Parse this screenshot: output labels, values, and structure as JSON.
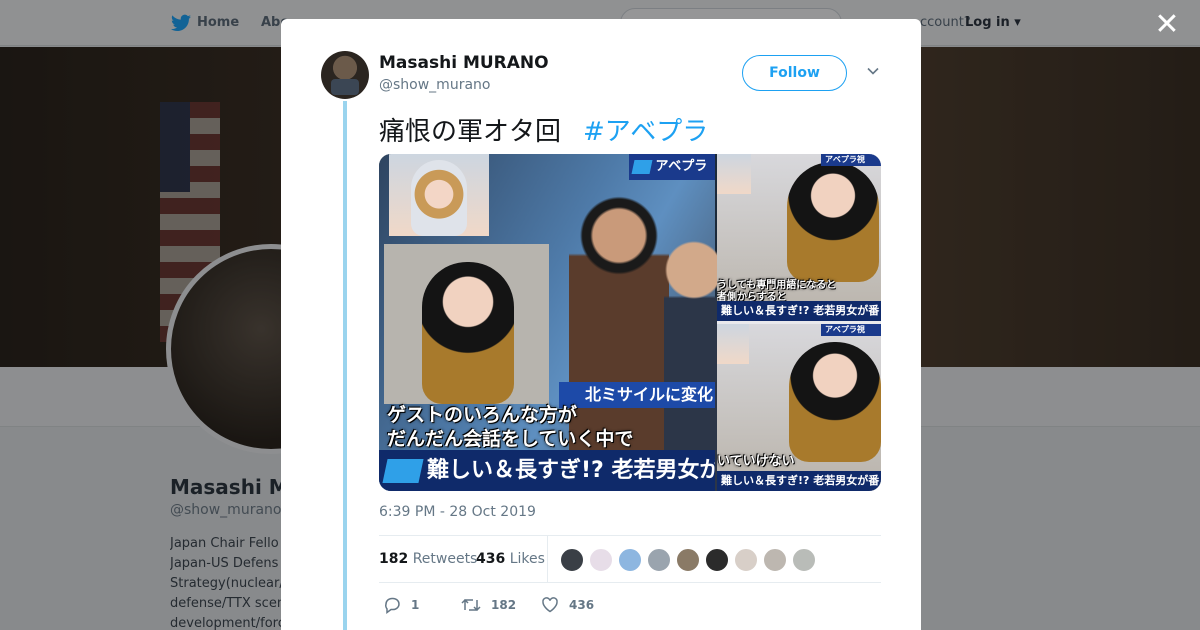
{
  "background_page": {
    "nav": {
      "home": "Home",
      "about": "Abo",
      "account_prompt": "ccount?",
      "login": "Log in"
    },
    "profile": {
      "name": "Masashi MU",
      "handle": "@show_murano",
      "bio_lines": [
        "Japan Chair Fello",
        "Japan-US Defens",
        "Strategy(nuclear/c",
        "defense/TTX scen",
        "development/forc"
      ]
    }
  },
  "tweet": {
    "author_name": "Masashi MURANO",
    "author_handle": "@show_murano",
    "follow_label": "Follow",
    "text": "痛恨の軍オタ回",
    "hashtag": "#アベプラ",
    "timestamp": "6:39 PM - 28 Oct 2019",
    "retweets_count": "182",
    "retweets_label": "Retweets",
    "likes_count": "436",
    "likes_label": "Likes",
    "replies": "1",
    "retweets_action": "182",
    "likes_action": "436",
    "likers": [
      "#3a3f46",
      "#e7dde8",
      "#8db6e0",
      "#9aa4ae",
      "#8a7a66",
      "#2b2b2b",
      "#d8cfc8",
      "#bdb7b0",
      "#b9bcb8"
    ]
  },
  "media": {
    "logo_text": "アベプラ",
    "logo_text_small": "アベプラ視",
    "main_caption_1": "ゲストのいろんな方が",
    "main_caption_2": "だんだん会話をしていく中で",
    "main_banner": "難しい＆長すぎ!? 老若男女が",
    "main_ticker": "北ミサイルに変化",
    "r1_caption_1": "うしても専門用語になると",
    "r1_caption_2": "者側からすると",
    "r1_banner": "難しい＆長すぎ!? 老若男女が番",
    "r2_caption": "いていけない",
    "r2_banner": "難しい＆長すぎ!? 老若男女が番"
  },
  "colors": {
    "accent": "#1da1f2",
    "thread": "#9ad4ee",
    "banner": "#0f2a6a"
  }
}
